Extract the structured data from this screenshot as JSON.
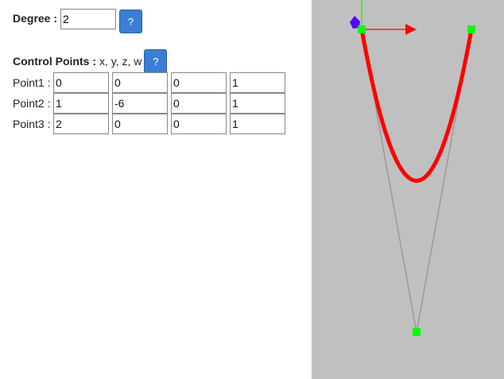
{
  "degree": {
    "label": "Degree :",
    "value": "2",
    "help_label": "?"
  },
  "control_points": {
    "label": "Control Points :",
    "hint": "x, y, z, w",
    "help_label": "?",
    "rows": [
      {
        "label": "Point1 :",
        "values": [
          "0",
          "0",
          "0",
          "1"
        ]
      },
      {
        "label": "Point2 :",
        "values": [
          "1",
          "-6",
          "0",
          "1"
        ]
      },
      {
        "label": "Point3 :",
        "values": [
          "2",
          "0",
          "0",
          "1"
        ]
      }
    ]
  },
  "viewport": {
    "background": "#c0c0c0",
    "curve_color": "#ff0000",
    "control_polygon_color": "#999999",
    "control_point_color": "#00ff00",
    "x_axis_color": "#ff0000",
    "y_axis_color": "#00ff00",
    "gizmo_color": "#5500ff"
  }
}
